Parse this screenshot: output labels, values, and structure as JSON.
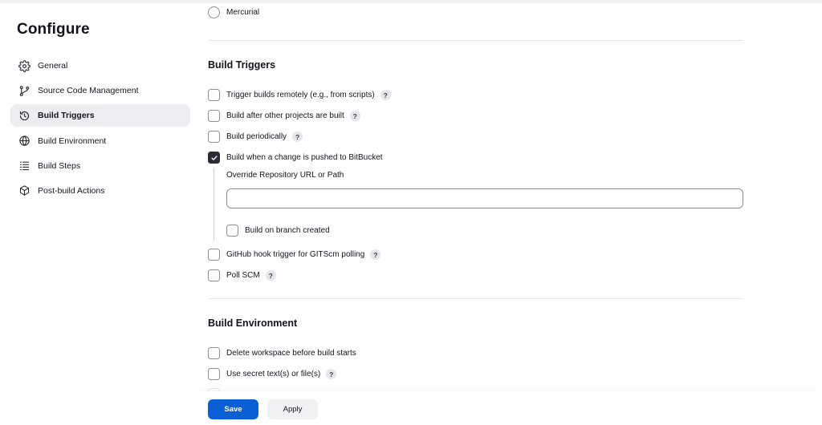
{
  "sidebar": {
    "title": "Configure",
    "items": [
      {
        "label": "General",
        "icon": "gear-icon"
      },
      {
        "label": "Source Code Management",
        "icon": "git-branch-icon"
      },
      {
        "label": "Build Triggers",
        "icon": "clock-refresh-icon",
        "active": true
      },
      {
        "label": "Build Environment",
        "icon": "globe-icon"
      },
      {
        "label": "Build Steps",
        "icon": "list-icon"
      },
      {
        "label": "Post-build Actions",
        "icon": "package-icon"
      }
    ]
  },
  "scm": {
    "mercurial_label": "Mercurial"
  },
  "build_triggers": {
    "title": "Build Triggers",
    "help_glyph": "?",
    "options": [
      {
        "label": "Trigger builds remotely (e.g., from scripts)",
        "checked": false
      },
      {
        "label": "Build after other projects are built",
        "checked": false
      },
      {
        "label": "Build periodically",
        "checked": false
      },
      {
        "label": "Build when a change is pushed to BitBucket",
        "checked": true
      },
      {
        "label": "GitHub hook trigger for GITScm polling",
        "checked": false
      },
      {
        "label": "Poll SCM",
        "checked": false
      }
    ],
    "bitbucket": {
      "override_label": "Override Repository URL or Path",
      "override_value": "",
      "branch_created_label": "Build on branch created",
      "branch_created_checked": false
    }
  },
  "build_environment": {
    "title": "Build Environment",
    "options": [
      {
        "label": "Delete workspace before build starts",
        "checked": false
      },
      {
        "label": "Use secret text(s) or file(s)",
        "checked": false
      }
    ]
  },
  "actions": {
    "save_label": "Save",
    "apply_label": "Apply"
  },
  "colors": {
    "primary": "#0b5fd6",
    "active_nav_bg": "#ececf1",
    "checked_box": "#2b2b36"
  }
}
